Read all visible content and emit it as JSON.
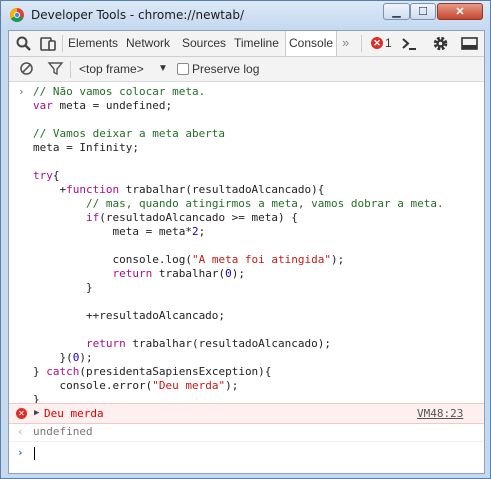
{
  "window": {
    "title": "Developer Tools - chrome://newtab/",
    "min_label": "▁",
    "max_label": "☐",
    "close_label": "✕"
  },
  "toolbar": {
    "tabs": [
      {
        "label": "Elements"
      },
      {
        "label": "Network"
      },
      {
        "label": "Sources"
      },
      {
        "label": "Timeline"
      },
      {
        "label": "Console"
      }
    ],
    "more_label": "»",
    "error_count": "1",
    "icons": [
      "inspect-icon",
      "device-icon",
      "error-icon",
      "console-drawer-icon",
      "gear-icon",
      "dock-icon"
    ]
  },
  "filterbar": {
    "frame": "<top frame>",
    "preserve_log_label": "Preserve log",
    "icons": [
      "clear-icon",
      "filter-icon",
      "chevron-down-icon"
    ]
  },
  "console": {
    "code_lines": [
      [
        {
          "t": "cm",
          "s": "// Não vamos colocar meta."
        }
      ],
      [
        {
          "t": "kw",
          "s": "var"
        },
        {
          "t": "tx",
          "s": " meta = undefined;"
        }
      ],
      [],
      [
        {
          "t": "cm",
          "s": "// Vamos deixar a meta aberta"
        }
      ],
      [
        {
          "t": "tx",
          "s": "meta = Infinity;"
        }
      ],
      [],
      [
        {
          "t": "kw",
          "s": "try"
        },
        {
          "t": "tx",
          "s": "{"
        }
      ],
      [
        {
          "t": "tx",
          "s": "    +"
        },
        {
          "t": "kw",
          "s": "function"
        },
        {
          "t": "tx",
          "s": " trabalhar(resultadoAlcancado){"
        }
      ],
      [
        {
          "t": "tx",
          "s": "        "
        },
        {
          "t": "cm",
          "s": "// mas, quando atingirmos a meta, vamos dobrar a meta."
        }
      ],
      [
        {
          "t": "tx",
          "s": "        "
        },
        {
          "t": "kw",
          "s": "if"
        },
        {
          "t": "tx",
          "s": "(resultadoAlcancado >= meta) {"
        }
      ],
      [
        {
          "t": "tx",
          "s": "            meta = meta*"
        },
        {
          "t": "nm",
          "s": "2"
        },
        {
          "t": "tx",
          "s": ";"
        }
      ],
      [],
      [
        {
          "t": "tx",
          "s": "            console.log("
        },
        {
          "t": "st",
          "s": "\"A meta foi atingida\""
        },
        {
          "t": "tx",
          "s": ");"
        }
      ],
      [
        {
          "t": "tx",
          "s": "            "
        },
        {
          "t": "kw",
          "s": "return"
        },
        {
          "t": "tx",
          "s": " trabalhar("
        },
        {
          "t": "nm",
          "s": "0"
        },
        {
          "t": "tx",
          "s": ");"
        }
      ],
      [
        {
          "t": "tx",
          "s": "        }"
        }
      ],
      [],
      [
        {
          "t": "tx",
          "s": "        ++resultadoAlcancado;"
        }
      ],
      [],
      [
        {
          "t": "tx",
          "s": "        "
        },
        {
          "t": "kw",
          "s": "return"
        },
        {
          "t": "tx",
          "s": " trabalhar(resultadoAlcancado);"
        }
      ],
      [
        {
          "t": "tx",
          "s": "    }("
        },
        {
          "t": "nm",
          "s": "0"
        },
        {
          "t": "tx",
          "s": ");"
        }
      ],
      [
        {
          "t": "tx",
          "s": "} "
        },
        {
          "t": "kw",
          "s": "catch"
        },
        {
          "t": "tx",
          "s": "(presidentaSapiensException){"
        }
      ],
      [
        {
          "t": "tx",
          "s": "    console.error("
        },
        {
          "t": "st",
          "s": "\"Deu merda\""
        },
        {
          "t": "tx",
          "s": ");"
        }
      ],
      [
        {
          "t": "tx",
          "s": "}"
        }
      ]
    ],
    "error_message": "Deu merda",
    "error_source": "VM48:23",
    "result_value": "undefined",
    "input_prompt": "›",
    "result_prompt": "‹",
    "code_prompt": "›"
  },
  "colors": {
    "comment": "#236e25",
    "keyword": "#aa0d91",
    "string": "#c41a16",
    "number": "#1c00cf",
    "error": "#dd0000",
    "titlebar": "#c5d8ef"
  }
}
